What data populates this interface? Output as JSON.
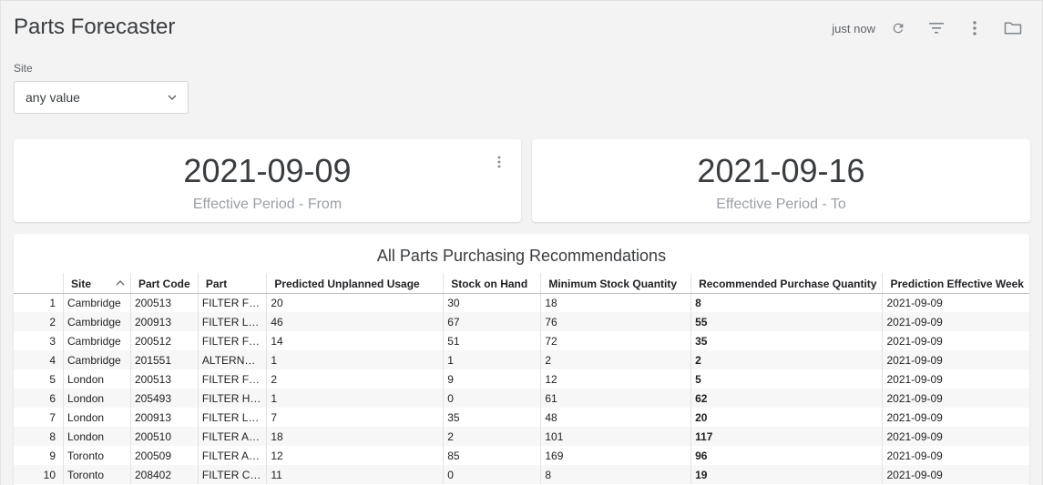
{
  "header": {
    "title": "Parts Forecaster",
    "updated": "just now",
    "icons": [
      "refresh-icon",
      "filter-icon",
      "more-vert-icon",
      "folder-icon"
    ]
  },
  "filter": {
    "label": "Site",
    "value": "any value"
  },
  "kpis": {
    "from": {
      "value": "2021-09-09",
      "label": "Effective Period - From"
    },
    "to": {
      "value": "2021-09-16",
      "label": "Effective Period - To"
    }
  },
  "table": {
    "title": "All Parts Purchasing Recommendations",
    "columns": [
      "Site",
      "Part Code",
      "Part",
      "Predicted Unplanned Usage",
      "Stock on Hand",
      "Minimum Stock Quantity",
      "Recommended Purchase Quantity",
      "Prediction Effective Week"
    ],
    "rows": [
      [
        "1",
        "Cambridge",
        "200513",
        "FILTER F…",
        "20",
        "30",
        "18",
        "8",
        "2021-09-09"
      ],
      [
        "2",
        "Cambridge",
        "200913",
        "FILTER L…",
        "46",
        "67",
        "76",
        "55",
        "2021-09-09"
      ],
      [
        "3",
        "Cambridge",
        "200512",
        "FILTER F…",
        "14",
        "51",
        "72",
        "35",
        "2021-09-09"
      ],
      [
        "4",
        "Cambridge",
        "201551",
        "ALTERN…",
        "1",
        "1",
        "2",
        "2",
        "2021-09-09"
      ],
      [
        "5",
        "London",
        "200513",
        "FILTER F…",
        "2",
        "9",
        "12",
        "5",
        "2021-09-09"
      ],
      [
        "6",
        "London",
        "205493",
        "FILTER H…",
        "1",
        "0",
        "61",
        "62",
        "2021-09-09"
      ],
      [
        "7",
        "London",
        "200913",
        "FILTER L…",
        "7",
        "35",
        "48",
        "20",
        "2021-09-09"
      ],
      [
        "8",
        "London",
        "200510",
        "FILTER A…",
        "18",
        "2",
        "101",
        "117",
        "2021-09-09"
      ],
      [
        "9",
        "Toronto",
        "200509",
        "FILTER A…",
        "12",
        "85",
        "169",
        "96",
        "2021-09-09"
      ],
      [
        "10",
        "Toronto",
        "208402",
        "FILTER C…",
        "11",
        "0",
        "8",
        "19",
        "2021-09-09"
      ]
    ]
  }
}
